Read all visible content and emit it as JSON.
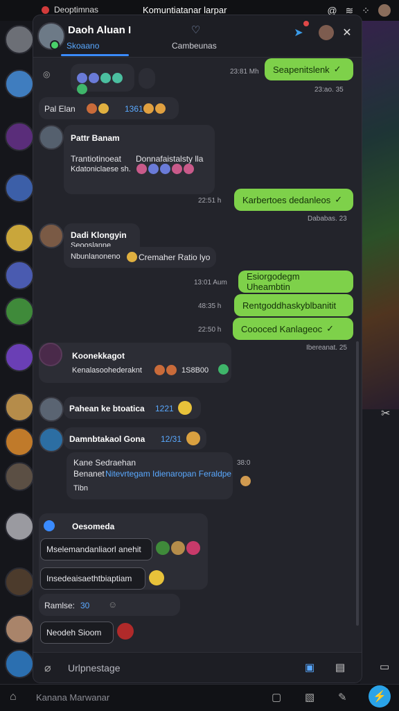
{
  "status_bar": {
    "left_text": "Deoptimnas",
    "center_text": "Komuntiatanar larpar"
  },
  "header": {
    "contact_name": "Daoh Aluan I",
    "tab_active": "Skoaano",
    "tab_other": "Cambeunas"
  },
  "messages": {
    "m1_time": "23:81 Mh",
    "m1_text": "Seapenitslenk",
    "m1_date": "23:ao. 35",
    "m2_text": "Pal Elan",
    "m2_time": "1361",
    "m3_sender": "Pattr Banam",
    "m3_line1": "Trantiotinoeat",
    "m3_line1b": "Donnafaistalsty lla",
    "m3_line2": "Kdatoniclaese sh.",
    "m4_time": "22:51 h",
    "m4_text": "Karbertoes dedanleos",
    "m4_date": "Dababas. 23",
    "m5_sender": "Dadi Klongyin",
    "m5_line1": "Seooslanne",
    "m5_line2": "Nbunlanoneno",
    "m5_line2b": "Cremaher Ratio lyo",
    "m6_time": "13:01 Aum",
    "m6_text": "Esiorgodegm Uheambtin",
    "m7_time": "48:35 h",
    "m7_text": "Rentgoddhaskyblbanitit",
    "m8_time": "22:50 h",
    "m8_text": "Coooced Kanlageoc",
    "m8_date": "Ibereanat. 25",
    "m9_sender": "Koonekkagot",
    "m9_text": "Kenalasoohederaknt",
    "m9_num": "1S8B00",
    "m10_text": "Pahean ke btoatica",
    "m10_time": "1221",
    "m11_sender": "Damnbtakaol Gona",
    "m11_time": "12/31",
    "m12_line1": "Kane Sedraehan",
    "m12_line2a": "Benanet",
    "m12_line2b": "Nitevrtegam Idienaropan Feraldpe",
    "m12_line3": "Tibn",
    "m12_side_time": "38:0",
    "m13_sender": "Oesomeda",
    "m13_text": "Mselemandanliaorl anehit",
    "m14_text": "Insedeaisaethtbiaptiam",
    "m15_text": "Ramlse:",
    "m15_num": "30",
    "m16_text": "Neodeh Sioom"
  },
  "composer": {
    "placeholder": "Urlpnestage"
  },
  "bottom_bar": {
    "label": "Kanana Marwanar"
  },
  "colors": {
    "accent": "#3a8bff",
    "outgoing": "#7ed14a",
    "panel": "#23242b"
  }
}
